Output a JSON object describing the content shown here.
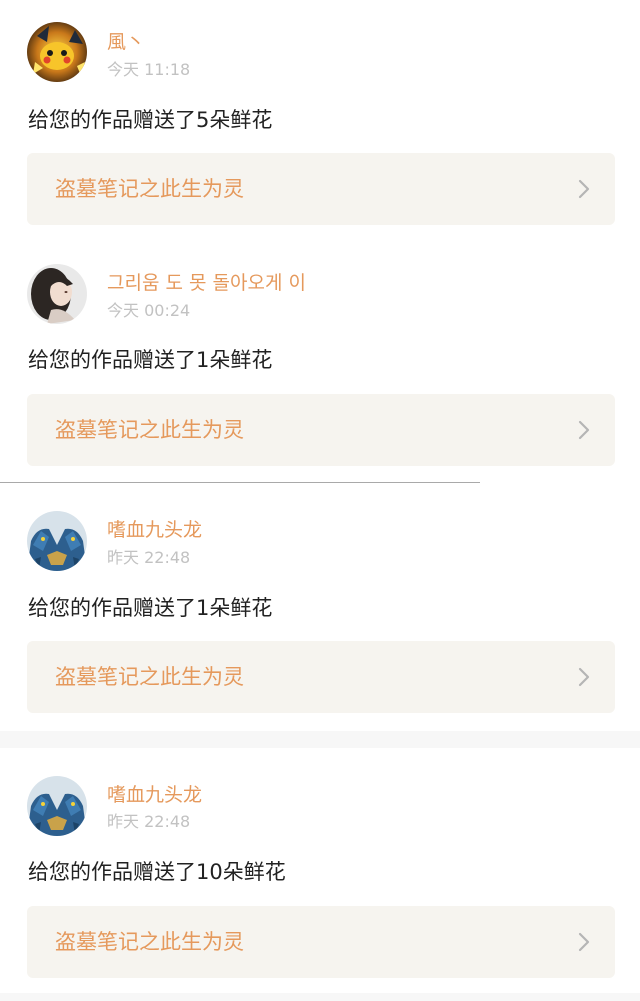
{
  "notifications": [
    {
      "username": "風丶",
      "time": "今天 11:18",
      "message": "给您的作品赠送了5朵鲜花",
      "work_title": "盗墓笔记之此生为灵",
      "avatar_icon": "pikachu-avatar-icon"
    },
    {
      "username": "그리움 도 못 돌아오게 이",
      "time": "今天 00:24",
      "message": "给您的作品赠送了1朵鲜花",
      "work_title": "盗墓笔记之此生为灵",
      "avatar_icon": "girl-portrait-avatar-icon"
    },
    {
      "username": "嗜血九头龙",
      "time": "昨天 22:48",
      "message": "给您的作品赠送了1朵鲜花",
      "work_title": "盗墓笔记之此生为灵",
      "avatar_icon": "blue-dragon-avatar-icon"
    },
    {
      "username": "嗜血九头龙",
      "time": "昨天 22:48",
      "message": "给您的作品赠送了10朵鲜花",
      "work_title": "盗墓笔记之此生为灵",
      "avatar_icon": "blue-dragon-avatar-icon"
    }
  ],
  "colors": {
    "accent": "#e5995c",
    "timestamp": "#c2c2c2",
    "message_text": "#222222",
    "link_card_bg": "#f6f4ef",
    "chevron": "#b5b5b5"
  },
  "icons": {
    "chevron": "chevron-right-icon"
  }
}
